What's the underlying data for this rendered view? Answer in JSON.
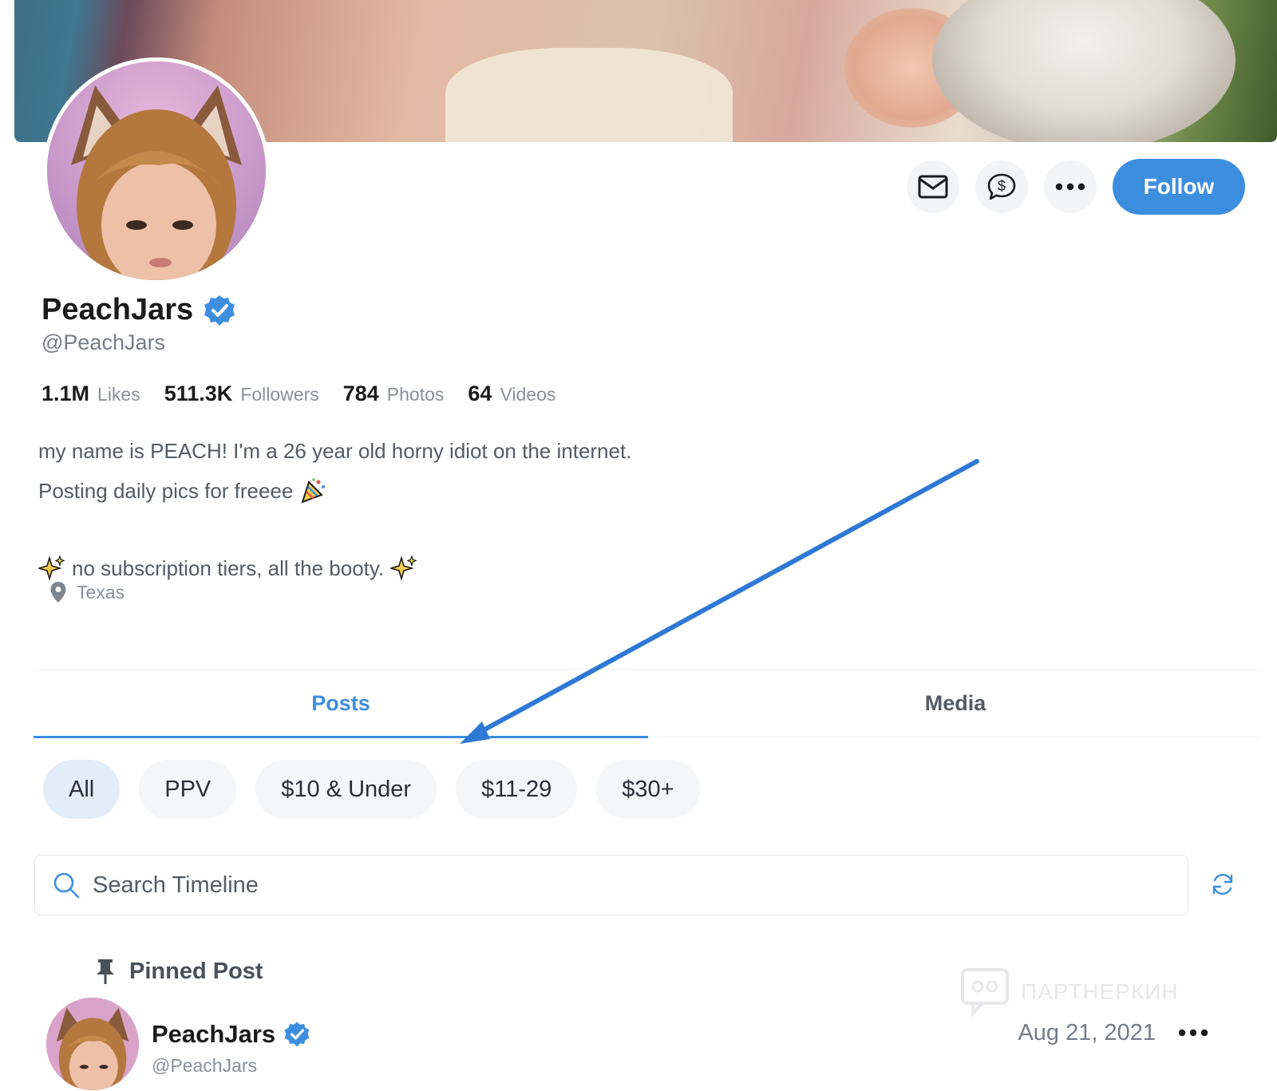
{
  "profile": {
    "name": "PeachJars",
    "handle": "@PeachJars",
    "stats": [
      {
        "value": "1.1M",
        "label": "Likes"
      },
      {
        "value": "511.3K",
        "label": "Followers"
      },
      {
        "value": "784",
        "label": "Photos"
      },
      {
        "value": "64",
        "label": "Videos"
      }
    ],
    "bio": {
      "line1": "my name is PEACH! I'm a 26 year old horny idiot on the internet.",
      "line2": "Posting daily pics for freeee",
      "line3": "no subscription tiers, all the booty."
    },
    "location": "Texas"
  },
  "actions": {
    "follow_label": "Follow"
  },
  "tabs": [
    {
      "label": "Posts",
      "active": true
    },
    {
      "label": "Media",
      "active": false
    }
  ],
  "filters": [
    {
      "label": "All",
      "active": true
    },
    {
      "label": "PPV",
      "active": false
    },
    {
      "label": "$10 & Under",
      "active": false
    },
    {
      "label": "$11-29",
      "active": false
    },
    {
      "label": "$30+",
      "active": false
    }
  ],
  "search": {
    "placeholder": "Search Timeline"
  },
  "pinned": {
    "label": "Pinned Post",
    "post": {
      "name": "PeachJars",
      "handle": "@PeachJars",
      "date": "Aug 21, 2021"
    }
  },
  "watermark": "ПАРТНЕРКИН",
  "colors": {
    "accent": "#3e8ee0",
    "chip_active_bg": "#e2edf9",
    "annotation_arrow": "#2f78d4"
  }
}
